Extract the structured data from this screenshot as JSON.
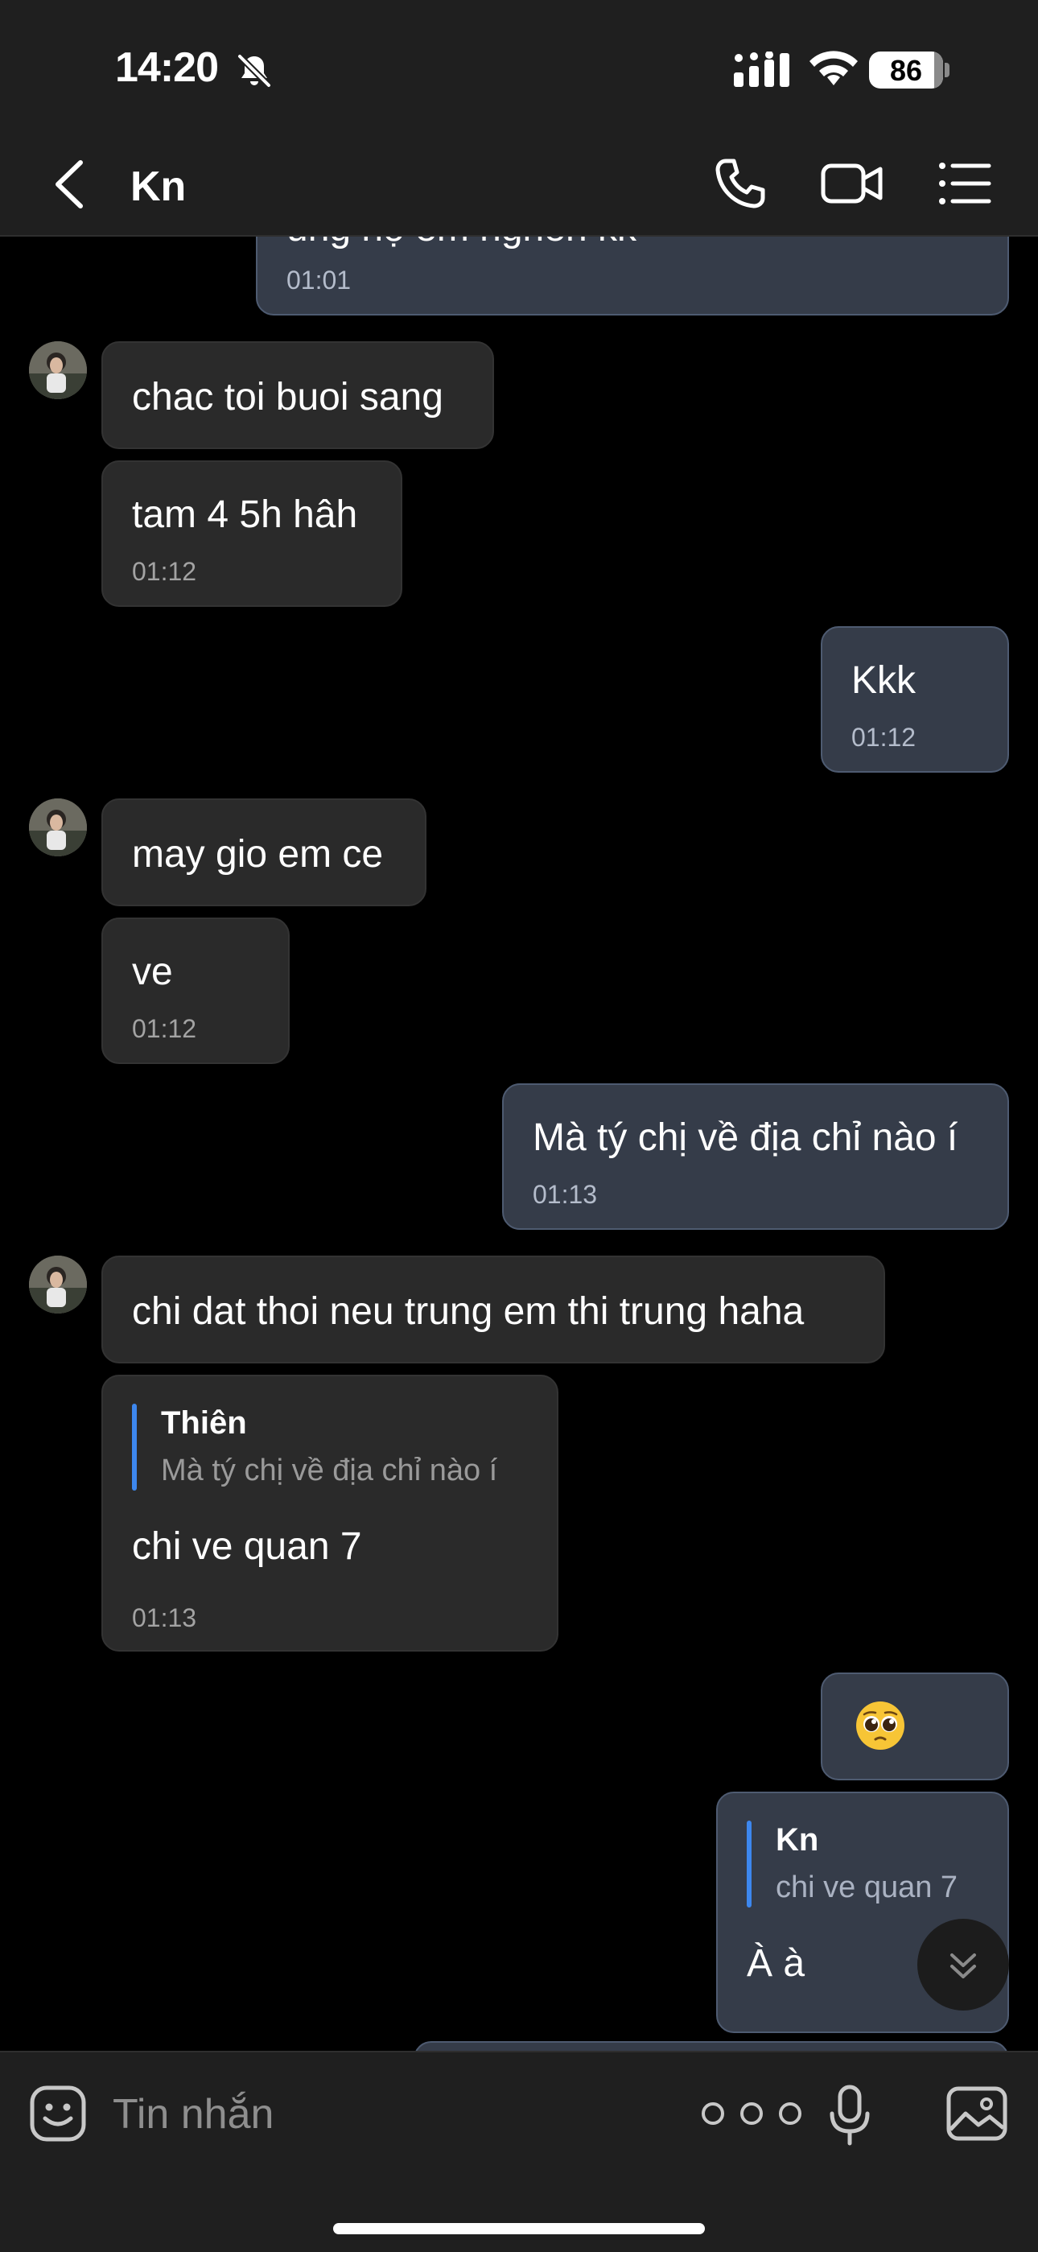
{
  "status_bar": {
    "time": "14:20",
    "battery": "86"
  },
  "header": {
    "title": "Kn"
  },
  "messages": [
    {
      "text": "ủng hộ em nghèn kk",
      "time": "01:01"
    },
    {
      "text": "chac toi buoi sang"
    },
    {
      "text": "tam 4 5h hâh",
      "time": "01:12"
    },
    {
      "text": "Kkk",
      "time": "01:12"
    },
    {
      "text": "may gio em ce"
    },
    {
      "text": "ve",
      "time": "01:12"
    },
    {
      "text": "Mà tý chị về địa chỉ nào í",
      "time": "01:13"
    },
    {
      "text": "chi dat thoi neu trung em thi trung haha"
    },
    {
      "quote_name": "Thiên",
      "quote_text": "Mà tý chị về địa chỉ nào í",
      "text": "chi ve quan 7",
      "time": "01:13"
    },
    {
      "emoji": "pleading-face"
    },
    {
      "quote_name": "Kn",
      "quote_text": "chi ve quan 7",
      "text": "À à"
    }
  ],
  "composer": {
    "placeholder": "Tin nhắn"
  },
  "colors": {
    "incoming_bubble": "#2a2a2a",
    "outgoing_bubble": "#353c49",
    "quote_accent": "#3d87ee"
  }
}
